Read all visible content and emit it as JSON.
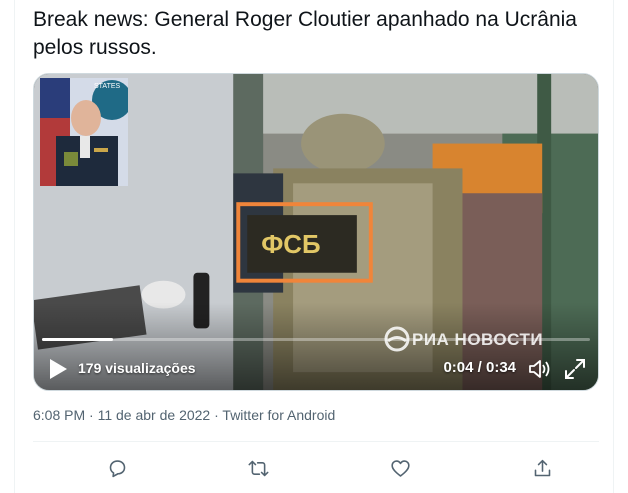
{
  "tweet": {
    "text": "Break news: General Roger Cloutier apanhado na Ucrânia pelos russos."
  },
  "video": {
    "views_label": "179 visualizações",
    "time_label": "0:04 / 0:34",
    "progress_fraction": 0.13,
    "watermark": "РИА НОВОСТИ",
    "vest_text": "ФСБ",
    "inset_banner": "STATES",
    "icons": {
      "play": "play-icon",
      "volume": "volume-icon",
      "fullscreen": "fullscreen-icon"
    }
  },
  "meta": {
    "time": "6:08 PM",
    "sep1": " · ",
    "date": "11 de abr de 2022",
    "sep2": " · ",
    "source": "Twitter for Android"
  },
  "actions": [
    {
      "icon": "reply-icon"
    },
    {
      "icon": "retweet-icon"
    },
    {
      "icon": "like-icon"
    },
    {
      "icon": "share-icon"
    }
  ],
  "colors": {
    "text": "#0f1419",
    "secondary": "#536471",
    "divider": "#eff3f4",
    "highlight_box": "#f0853a"
  }
}
